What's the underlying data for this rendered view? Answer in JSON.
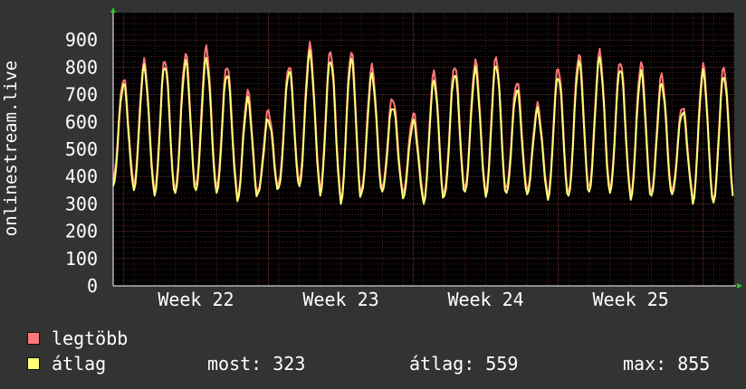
{
  "chart_data": {
    "type": "line",
    "ylabel": "onlinestream.live",
    "ylim": [
      0,
      1000
    ],
    "yticks": [
      "0",
      "100",
      "200",
      "300",
      "400",
      "500",
      "600",
      "700",
      "800",
      "900"
    ],
    "xticks": [
      "Week 22",
      "Week 23",
      "Week 24",
      "Week 25"
    ],
    "grid": true,
    "colors": {
      "background": "#333333",
      "plot": "#000000",
      "max": "#ff7777",
      "avg": "#ffff77"
    },
    "series": [
      {
        "name": "legtöbb",
        "color": "#ff7777",
        "day_min": [
          390,
          370,
          345,
          355,
          370,
          360,
          320,
          350,
          380,
          385,
          350,
          310,
          355,
          360,
          340,
          305,
          350,
          360,
          340,
          360,
          350,
          330,
          345,
          365,
          355,
          330,
          345,
          350,
          310,
          315
        ],
        "day_max": [
          760,
          820,
          830,
          850,
          870,
          810,
          710,
          640,
          810,
          880,
          860,
          860,
          800,
          690,
          630,
          780,
          810,
          820,
          835,
          750,
          660,
          800,
          850,
          855,
          825,
          815,
          770,
          660,
          805,
          800
        ]
      },
      {
        "name": "átlag",
        "color": "#ffff77",
        "day_min": [
          365,
          350,
          330,
          340,
          350,
          340,
          310,
          340,
          360,
          365,
          330,
          300,
          340,
          345,
          320,
          300,
          330,
          345,
          325,
          340,
          335,
          315,
          330,
          345,
          340,
          315,
          330,
          335,
          300,
          305
        ],
        "day_max": [
          740,
          800,
          810,
          820,
          830,
          780,
          680,
          610,
          790,
          850,
          830,
          830,
          770,
          660,
          600,
          750,
          780,
          790,
          810,
          720,
          640,
          770,
          820,
          830,
          800,
          780,
          740,
          640,
          780,
          770
        ]
      }
    ]
  },
  "legend": {
    "max_label": "legtöbb",
    "avg_label": "átlag",
    "most": "most: 323",
    "atlag": "átlag: 559",
    "max": "max: 855"
  }
}
